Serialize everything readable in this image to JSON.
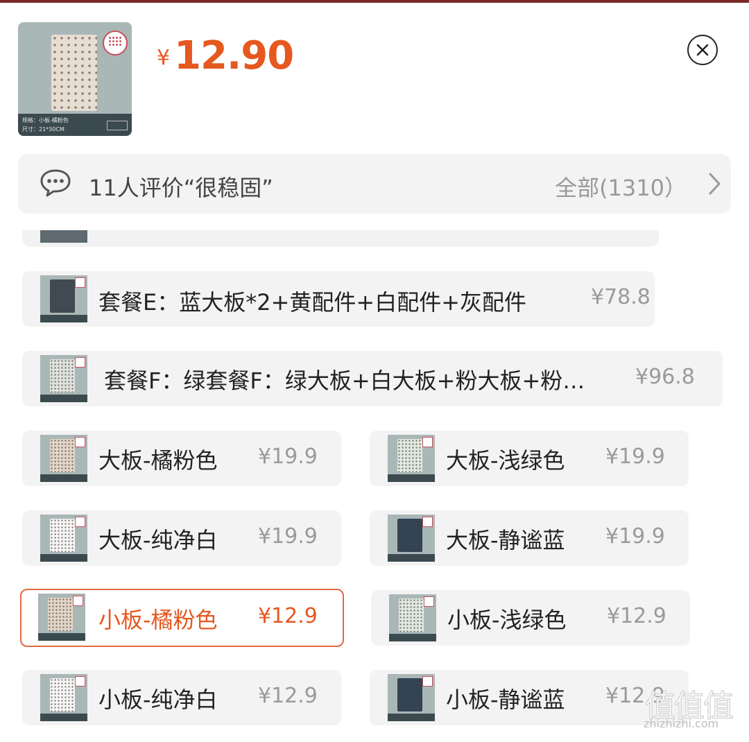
{
  "product": {
    "price_currency": "¥",
    "price_value": "12.90",
    "thumb_caption_line1": "规格：小板-橘粉色",
    "thumb_caption_line2": "尺寸：21*30CM"
  },
  "review": {
    "summary": "11人评价“很稳固”",
    "all_label": "全部(1310）"
  },
  "options": [
    {
      "label": "套餐E：蓝大板*2+黄配件+白配件+灰配件",
      "price": "¥78.8",
      "thumb_color": "#3f4a55",
      "selected": false
    },
    {
      "label": "套餐F：绿套餐F：绿大板+白大板+粉大板+粉…",
      "price": "¥96.8",
      "thumb_color": "#dfe3df",
      "selected": false
    },
    {
      "label": "大板-橘粉色",
      "price": "¥19.9",
      "thumb_color": "#e3d6c8",
      "selected": false
    },
    {
      "label": "大板-浅绿色",
      "price": "¥19.9",
      "thumb_color": "#dfe9e2",
      "selected": false
    },
    {
      "label": "大板-纯净白",
      "price": "¥19.9",
      "thumb_color": "#f6f6f6",
      "selected": false
    },
    {
      "label": "大板-静谧蓝",
      "price": "¥19.9",
      "thumb_color": "#2f4356",
      "selected": false
    },
    {
      "label": "小板-橘粉色",
      "price": "¥12.9",
      "thumb_color": "#e3d6c8",
      "selected": true
    },
    {
      "label": "小板-浅绿色",
      "price": "¥12.9",
      "thumb_color": "#dfe9e2",
      "selected": false
    },
    {
      "label": "小板-纯净白",
      "price": "¥12.9",
      "thumb_color": "#f6f6f6",
      "selected": false
    },
    {
      "label": "小板-静谧蓝",
      "price": "¥12.9",
      "thumb_color": "#2f4356",
      "selected": false
    }
  ],
  "watermark": {
    "glyphs": "值值值",
    "site": "zhizhizhi.com"
  },
  "colors": {
    "accent": "#e5581f",
    "selected_border": "#e06a42",
    "option_bg": "#f3f3f3"
  }
}
